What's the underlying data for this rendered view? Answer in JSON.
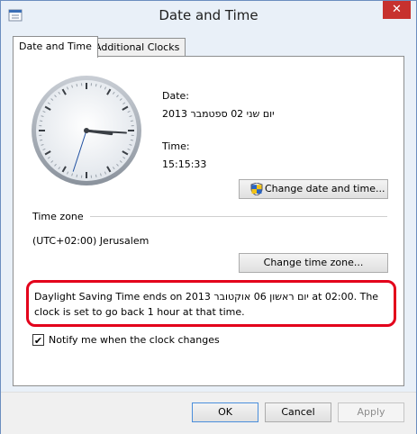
{
  "window": {
    "title": "Date and Time",
    "close_glyph": "✕"
  },
  "tabs": [
    {
      "label": "Date and Time",
      "active": true
    },
    {
      "label": "Additional Clocks",
      "active": false
    }
  ],
  "date": {
    "label": "Date:",
    "value": "יום שני 02 ספטמבר 2013"
  },
  "time": {
    "label": "Time:",
    "value": "15:15:33"
  },
  "buttons": {
    "change_date_time": "Change date and time...",
    "change_time_zone": "Change time zone...",
    "ok": "OK",
    "cancel": "Cancel",
    "apply": "Apply"
  },
  "time_zone": {
    "heading": "Time zone",
    "value": "(UTC+02:00) Jerusalem"
  },
  "dst_notice": "Daylight Saving Time ends on יום ראשון 06 אוקטובר 2013 at 02:00. The clock is set to go back 1 hour at that time.",
  "notify": {
    "label": "Notify me when the clock changes",
    "checked": true,
    "mark": "✔"
  },
  "clock_time": {
    "hours": 15,
    "minutes": 15,
    "seconds": 33
  },
  "colors": {
    "alert_border": "#e3001b",
    "close_button": "#c7312e"
  },
  "icons": {
    "app": "clock-icon",
    "shield": "uac-shield-icon"
  }
}
